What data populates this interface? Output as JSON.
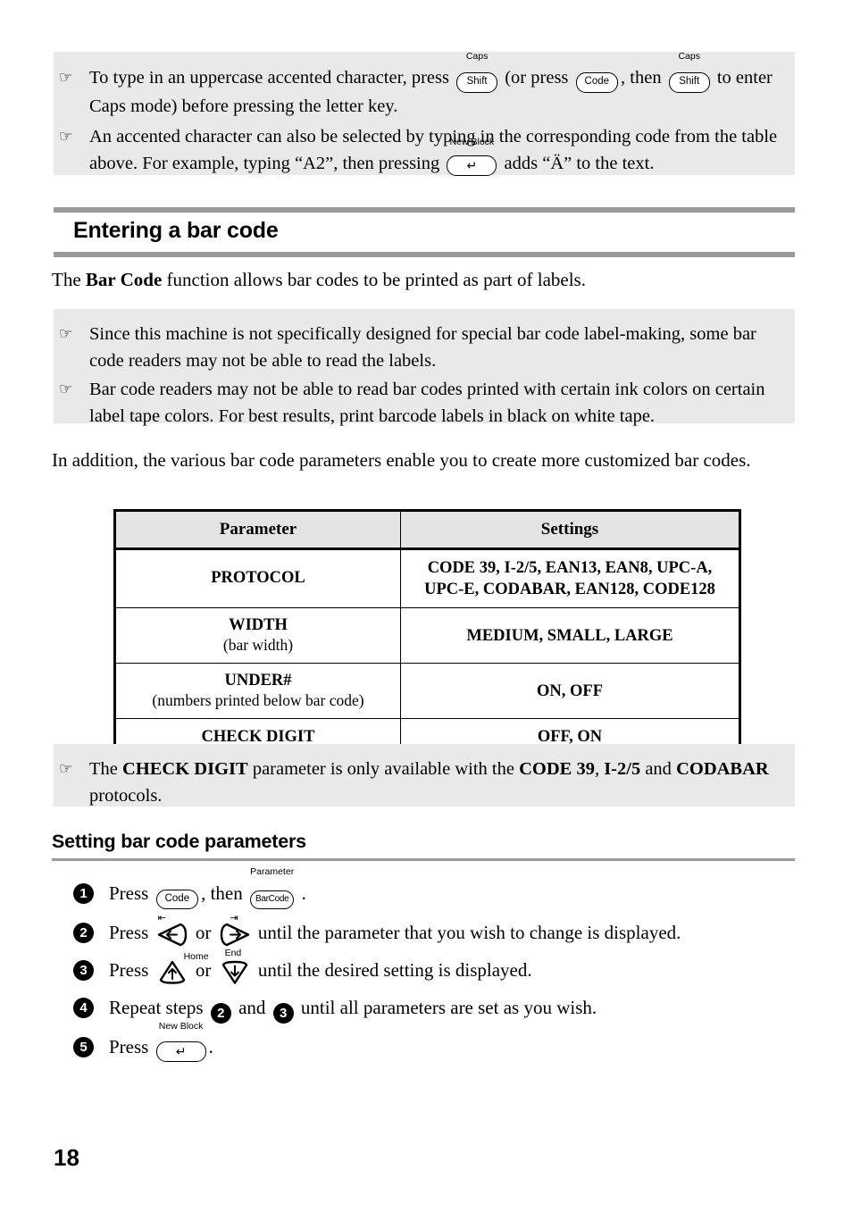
{
  "document": {
    "page_number": "18",
    "colors": {
      "note_background": "#e9e9e9",
      "rule_gray": "#9a9a9a",
      "table_header_background": "#e4e4e4",
      "text": "#000000"
    }
  },
  "top_note": {
    "bullet_glyph": "☞",
    "items": [
      {
        "segments": [
          {
            "type": "text",
            "value": "To type in an uppercase accented character, press "
          },
          {
            "type": "key",
            "label": "Caps",
            "cap": "Shift"
          },
          {
            "type": "text",
            "value": " (or press "
          },
          {
            "type": "key",
            "label": "",
            "cap": "Code"
          },
          {
            "type": "text",
            "value": ", then "
          },
          {
            "type": "key",
            "label": "Caps",
            "cap": "Shift"
          },
          {
            "type": "text",
            "value": " to enter Caps mode) before pressing the letter key."
          }
        ]
      },
      {
        "segments": [
          {
            "type": "text",
            "value": "An accented character can also be selected by typing in the corresponding code from the table above. For example, typing “A2”, then pressing "
          },
          {
            "type": "key",
            "label": "New Block",
            "cap": "↵"
          },
          {
            "type": "text",
            "value": " adds “Ä” to the text."
          }
        ]
      }
    ]
  },
  "section": {
    "title": "Entering a bar code",
    "intro": {
      "before": "The ",
      "bold": "Bar Code",
      "after": " function allows bar codes to be printed as part of labels."
    }
  },
  "warning_note": {
    "bullet_glyph": "☞",
    "items": [
      "Since this machine is not specifically designed for special bar code label-making, some bar code readers may not be able to read the labels.",
      "Bar code readers may not be able to read bar codes printed with certain ink colors on certain label tape colors. For best results, print barcode labels in black on white tape."
    ]
  },
  "addition_paragraph": "In addition, the various bar code parameters enable you to create more customized bar codes.",
  "table": {
    "headers": [
      "Parameter",
      "Settings"
    ],
    "rows": [
      {
        "parameter": "PROTOCOL",
        "parameter_sub": "",
        "settings": "CODE 39, I-2/5, EAN13, EAN8, UPC-A, UPC-E, CODABAR, EAN128, CODE128"
      },
      {
        "parameter": "WIDTH",
        "parameter_sub": "(bar width)",
        "settings": "MEDIUM, SMALL, LARGE"
      },
      {
        "parameter": "UNDER#",
        "parameter_sub": "(numbers printed below bar code)",
        "settings": "ON, OFF"
      },
      {
        "parameter": "CHECK DIGIT",
        "parameter_sub": "",
        "settings": "OFF, ON"
      }
    ]
  },
  "check_digit_note": {
    "bullet_glyph": "☞",
    "text_parts": {
      "p1": "The ",
      "b1": "CHECK DIGIT",
      "p2": " parameter is only available with the ",
      "b2": "CODE 39",
      "p3": ", ",
      "b3": "I-2/5",
      "p4": " and ",
      "b4": "CODABAR",
      "p5": " protocols."
    }
  },
  "procedure": {
    "title": "Setting bar code parameters",
    "steps": [
      {
        "number": "1",
        "parts": {
          "p1": "Press ",
          "key1": {
            "label": "",
            "cap": "Code"
          },
          "p2": ", then ",
          "key2": {
            "label": "Parameter",
            "cap": "BarCode"
          },
          "p3": " ."
        }
      },
      {
        "number": "2",
        "parts": {
          "p1": "Press ",
          "key1": {
            "label": "",
            "cap": "←"
          },
          "p2": " or ",
          "key2": {
            "label": "",
            "cap": "→"
          },
          "p3": " until the parameter that you wish to change is displayed."
        }
      },
      {
        "number": "3",
        "parts": {
          "p1": "Press ",
          "key1": {
            "label": "Home",
            "cap": "↑"
          },
          "p2": "  or ",
          "key2": {
            "label": "End",
            "cap": "↓"
          },
          "p3": " until the desired setting is displayed."
        }
      },
      {
        "number": "4",
        "parts": {
          "p1": "Repeat steps ",
          "ref1": "2",
          "p2": " and ",
          "ref2": "3",
          "p3": " until all parameters are set as you wish."
        }
      },
      {
        "number": "5",
        "parts": {
          "p1": "Press ",
          "key1": {
            "label": "New Block",
            "cap": "↵"
          },
          "p2": "."
        }
      }
    ]
  }
}
